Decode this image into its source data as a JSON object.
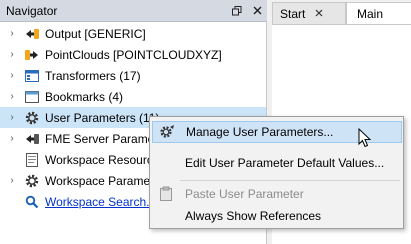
{
  "navigator": {
    "title": "Navigator",
    "float_icon": "float-icon",
    "close_icon": "close-icon",
    "items": [
      {
        "label": "Output [GENERIC]",
        "icon": "writer-output-icon",
        "expandable": true
      },
      {
        "label": "PointClouds [POINTCLOUDXYZ]",
        "icon": "reader-input-icon",
        "expandable": true
      },
      {
        "label": "Transformers (17)",
        "icon": "transformers-icon",
        "expandable": true
      },
      {
        "label": "Bookmarks (4)",
        "icon": "bookmarks-icon",
        "expandable": true
      },
      {
        "label": "User Parameters (11)",
        "icon": "gear-icon",
        "expandable": true,
        "selected": true
      },
      {
        "label": "FME Server Parameters",
        "icon": "server-icon",
        "expandable": true
      },
      {
        "label": "Workspace Resources",
        "icon": "resources-icon",
        "expandable": false
      },
      {
        "label": "Workspace Parameters",
        "icon": "gear-icon",
        "expandable": true
      },
      {
        "label": "Workspace Search...",
        "icon": "search-icon",
        "expandable": false,
        "link": true
      }
    ]
  },
  "tabs": [
    {
      "label": "Start",
      "active": false
    },
    {
      "label": "Main",
      "active": true
    }
  ],
  "context_menu": {
    "items": [
      {
        "label": "Manage User Parameters...",
        "icon": "manage-parameters-icon",
        "highlighted": true,
        "disabled": false
      },
      {
        "label": "Edit User Parameter Default Values...",
        "icon": "",
        "highlighted": false,
        "disabled": false
      },
      {
        "label": "Paste User Parameter",
        "icon": "paste-icon",
        "highlighted": false,
        "disabled": true
      },
      {
        "label": "Always Show References",
        "icon": "",
        "highlighted": false,
        "disabled": false
      }
    ]
  },
  "colors": {
    "header_bg": "#d5dae2",
    "selected_row": "#cce4f7",
    "menu_highlight": "#cfe3f7",
    "link": "#0033cc"
  }
}
